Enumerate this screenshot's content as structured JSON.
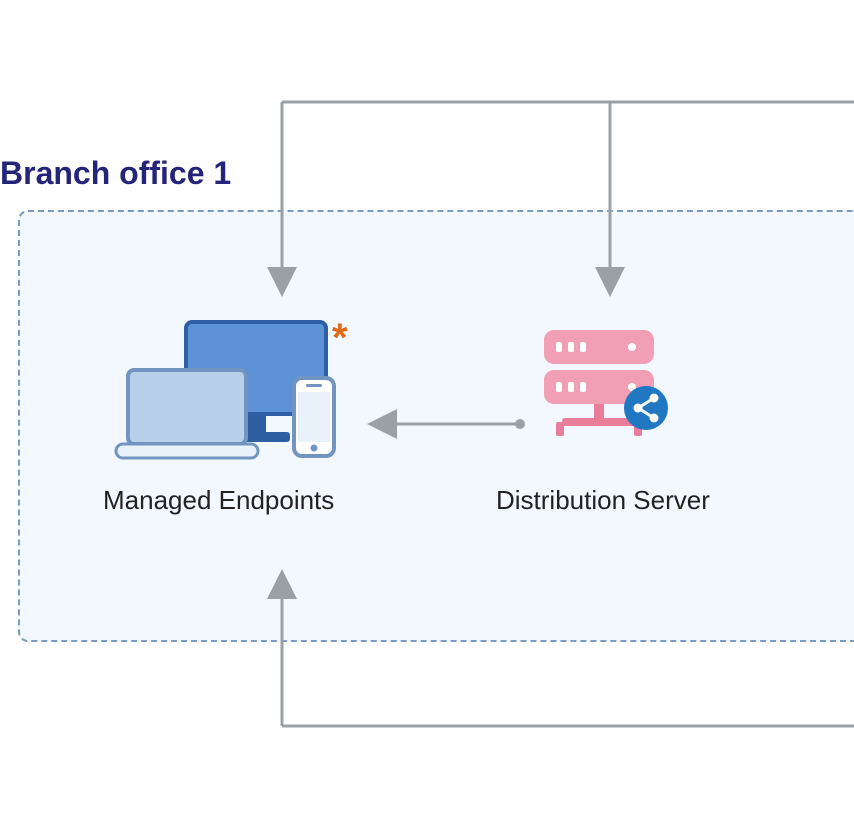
{
  "title": "Branch office 1",
  "asterisk": "*",
  "nodes": {
    "endpoints": {
      "label": "Managed Endpoints"
    },
    "server": {
      "label": "Distribution Server"
    }
  },
  "colors": {
    "title": "#23247a",
    "boxBorder": "#7c9bc0",
    "boxFill": "#f3f8fe",
    "arrow": "#9aa0a6",
    "monitorFill": "#5e92d6",
    "monitorStroke": "#2e5fa3",
    "laptopFill": "#b8cfea",
    "laptopStroke": "#7294c0",
    "phoneFill": "#ffffff",
    "phoneStroke": "#7294c0",
    "serverFill": "#f19fb4",
    "serverDark": "#ea7d9a",
    "shareCircle": "#1f78c1",
    "asterisk": "#e06a1a"
  }
}
